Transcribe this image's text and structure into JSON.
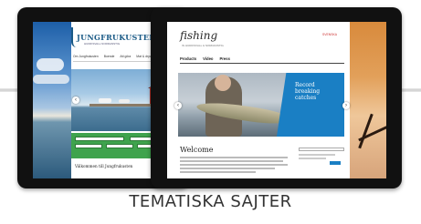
{
  "caption": "TEMATISKA SAJTER",
  "tablet_back": {
    "site": {
      "logo": "JUNGFRUKUSTEN",
      "logo_sub": "HUDIKSVALL NORDANSTIG",
      "nav": [
        "Om Jungfrukusten",
        "Boende",
        "Att göra",
        "Mat & dryck"
      ],
      "welcome": "Välkommen till Jungfrukusten"
    }
  },
  "tablet_front": {
    "site": {
      "logo": "fishing",
      "logo_sub": "IN HUDIKSVALL & NORDANSTIG",
      "lang": "SVENSKA",
      "nav": [
        "Products",
        "Video",
        "Press"
      ],
      "hero_text": "Record breaking catches",
      "welcome": "Welcome"
    }
  },
  "colors": {
    "frame": "#111111",
    "accent_blue": "#1a7fc4",
    "accent_green": "#3fa34d"
  }
}
